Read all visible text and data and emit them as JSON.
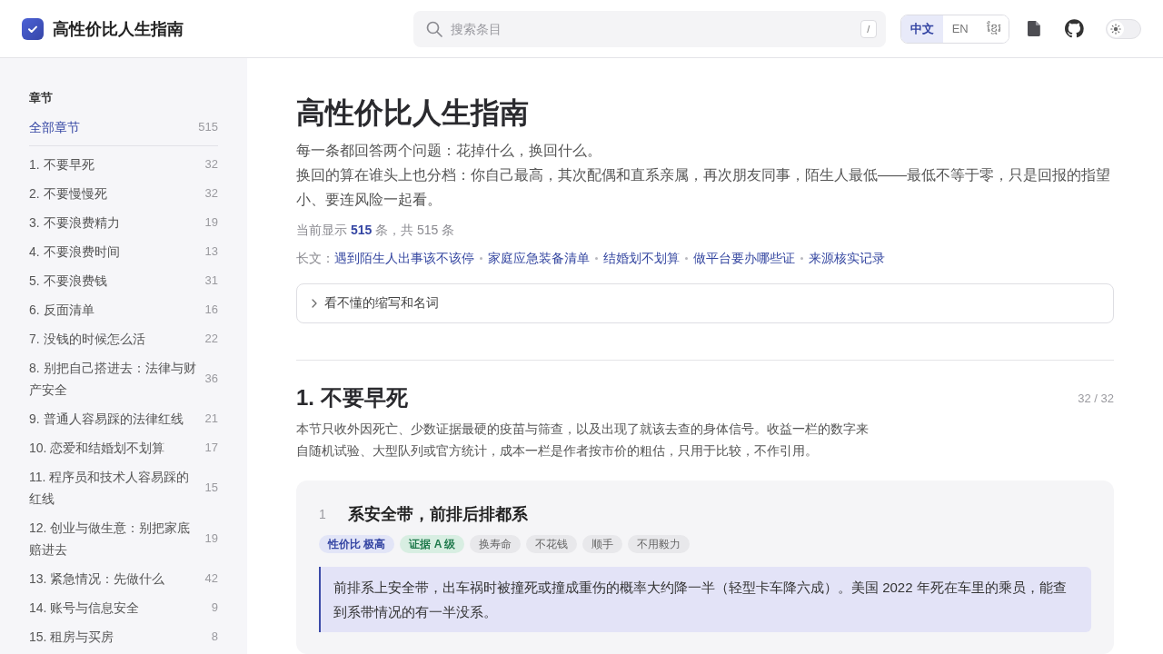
{
  "header": {
    "title": "高性价比人生指南",
    "search": {
      "placeholder": "搜索条目",
      "shortcut": "/"
    },
    "languages": [
      {
        "label": "中文",
        "selected": true
      },
      {
        "label": "EN",
        "selected": false
      },
      {
        "label": "ខ្មែរ",
        "selected": false
      }
    ],
    "theme_toggle": {
      "on": false
    }
  },
  "sidebar": {
    "heading": "章节",
    "all": {
      "label": "全部章节",
      "count": "515",
      "selected": true
    },
    "items": [
      {
        "label": "1. 不要早死",
        "count": "32",
        "selected": false
      },
      {
        "label": "2. 不要慢慢死",
        "count": "32",
        "selected": false
      },
      {
        "label": "3. 不要浪费精力",
        "count": "19",
        "selected": false
      },
      {
        "label": "4. 不要浪费时间",
        "count": "13",
        "selected": false
      },
      {
        "label": "5. 不要浪费钱",
        "count": "31",
        "selected": false
      },
      {
        "label": "6. 反面清单",
        "count": "16",
        "selected": false
      },
      {
        "label": "7. 没钱的时候怎么活",
        "count": "22",
        "selected": false
      },
      {
        "label": "8. 别把自己搭进去：法律与财产安全",
        "count": "36",
        "selected": false
      },
      {
        "label": "9. 普通人容易踩的法律红线",
        "count": "21",
        "selected": false
      },
      {
        "label": "10. 恋爱和结婚划不划算",
        "count": "17",
        "selected": false
      },
      {
        "label": "11. 程序员和技术人容易踩的红线",
        "count": "15",
        "selected": false
      },
      {
        "label": "12. 创业与做生意：别把家底赔进去",
        "count": "19",
        "selected": false
      },
      {
        "label": "13. 紧急情况：先做什么",
        "count": "42",
        "selected": false
      },
      {
        "label": "14. 账号与信息安全",
        "count": "9",
        "selected": false
      },
      {
        "label": "15. 租房与买房",
        "count": "8",
        "selected": false
      }
    ]
  },
  "intro": {
    "title": "高性价比人生指南",
    "paragraphs": [
      "每一条都回答两个问题：花掉什么，换回什么。",
      "换回的算在谁头上也分档：你自己最高，其次配偶和直系亲属，再次朋友同事，陌生人最低——最低不等于零，只是回报的指望小、要连风险一起看。"
    ],
    "count_line": "当前显示 **515** 条，共 515 条",
    "longreads": {
      "label": "长文：",
      "links": [
        "遇到陌生人出事该不该停",
        "家庭应急装备清单",
        "结婚划不划算",
        "做平台要办哪些证",
        "来源核实记录"
      ]
    },
    "glossary": {
      "label": "看不懂的缩写和名词",
      "expanded": false
    }
  },
  "section": {
    "title": "1. 不要早死",
    "progress": "32 / 32",
    "description": "本节只收外因死亡、少数证据最硬的疫苗与筛查，以及出现了就该去查的身体信号。收益一栏的数字来自随机试验、大型队列或官方统计，成本一栏是作者按市价的粗估，只用于比较，不作引用。",
    "entries": [
      {
        "number": "1",
        "title": "系安全带，前排后排都系",
        "tags": [
          {
            "kind": "rating",
            "label": "性价比 极高"
          },
          {
            "kind": "evidence",
            "label": "证据 A 级"
          },
          {
            "kind": "topic",
            "label": "换寿命"
          },
          {
            "kind": "topic",
            "label": "不花钱"
          },
          {
            "kind": "topic",
            "label": "顺手"
          },
          {
            "kind": "topic",
            "label": "不用毅力"
          }
        ],
        "summary": "前排系上安全带，出车祸时被撞死或撞成重伤的概率大约降一半（轻型卡车降六成）。美国 2022 年死在车里的乘员，能查到系带情况的有一半没系。"
      }
    ]
  }
}
